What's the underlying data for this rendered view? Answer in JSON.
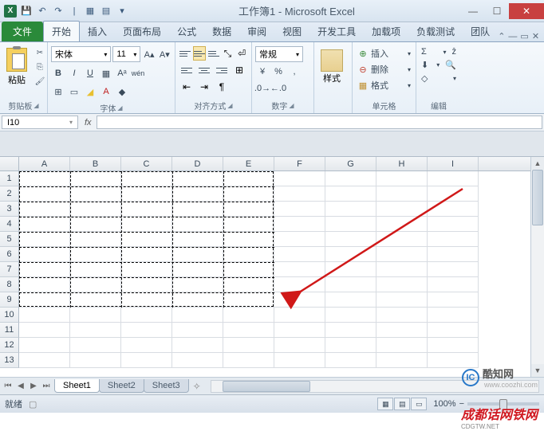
{
  "titlebar": {
    "title": "工作簿1 - Microsoft Excel"
  },
  "ribbon": {
    "file_tab": "文件",
    "tabs": [
      "开始",
      "插入",
      "页面布局",
      "公式",
      "数据",
      "审阅",
      "视图",
      "开发工具",
      "加载项",
      "负载测试",
      "团队"
    ],
    "active_tab_index": 0,
    "clipboard": {
      "label": "剪贴板",
      "paste": "粘贴"
    },
    "font": {
      "label": "字体",
      "name": "宋体",
      "size": "11"
    },
    "alignment": {
      "label": "对齐方式"
    },
    "number": {
      "label": "数字",
      "format": "常规"
    },
    "styles": {
      "label": "样式"
    },
    "cells": {
      "label": "单元格",
      "insert": "插入",
      "delete": "删除",
      "format": "格式"
    },
    "editing": {
      "label": "编辑"
    }
  },
  "formula_bar": {
    "name_box": "I10",
    "fx": "fx",
    "formula": ""
  },
  "grid": {
    "columns": [
      {
        "h": "A",
        "w": 64
      },
      {
        "h": "B",
        "w": 64
      },
      {
        "h": "C",
        "w": 64
      },
      {
        "h": "D",
        "w": 64
      },
      {
        "h": "E",
        "w": 64
      },
      {
        "h": "F",
        "w": 64
      },
      {
        "h": "G",
        "w": 64
      },
      {
        "h": "H",
        "w": 64
      },
      {
        "h": "I",
        "w": 64
      }
    ],
    "row_count": 13,
    "dash_range": {
      "r1": 1,
      "r2": 9,
      "c1": 1,
      "c2": 5
    }
  },
  "sheet_tabs": [
    "Sheet1",
    "Sheet2",
    "Sheet3"
  ],
  "statusbar": {
    "ready": "就绪",
    "zoom": "100%"
  },
  "watermarks": {
    "kz_badge": "IC",
    "kz_name": "酷知网",
    "kz_url": "www.coozhi.com",
    "cd_name": "成都话网铁网",
    "cd_url": "CDGTW.NET"
  }
}
